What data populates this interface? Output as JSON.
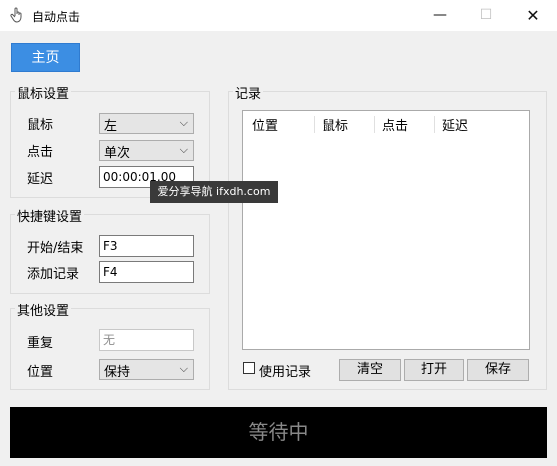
{
  "window": {
    "title": "自动点击",
    "minimize": "—",
    "maximize": "☐",
    "close": "✕"
  },
  "home_button": "主页",
  "mouse_settings": {
    "title": "鼠标设置",
    "mouse_label": "鼠标",
    "mouse_value": "左",
    "click_label": "点击",
    "click_value": "单次",
    "delay_label": "延迟",
    "delay_value": "00:00:01.00"
  },
  "hotkey_settings": {
    "title": "快捷键设置",
    "start_stop_label": "开始/结束",
    "start_stop_value": "F3",
    "add_record_label": "添加记录",
    "add_record_value": "F4"
  },
  "other_settings": {
    "title": "其他设置",
    "repeat_label": "重复",
    "repeat_placeholder": "无",
    "position_label": "位置",
    "position_value": "保持"
  },
  "records": {
    "title": "记录",
    "columns": [
      "位置",
      "鼠标",
      "点击",
      "延迟"
    ],
    "use_records_label": "使用记录",
    "clear_button": "清空",
    "open_button": "打开",
    "save_button": "保存"
  },
  "status": "等待中",
  "watermark": "爱分享导航 ifxdh.com",
  "icons": {
    "chevron": "⌵"
  }
}
